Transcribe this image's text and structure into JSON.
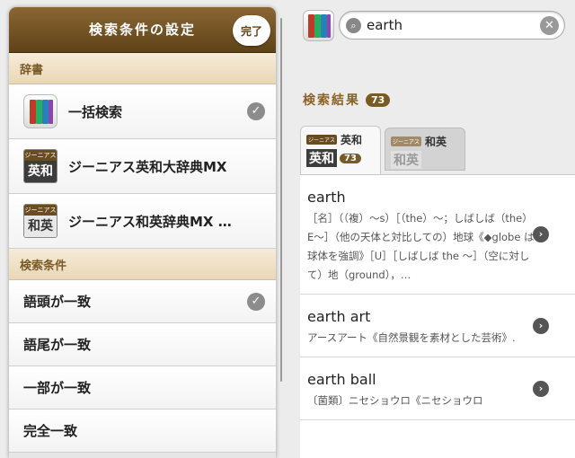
{
  "settings": {
    "title": "検索条件の設定",
    "done_label": "完了",
    "section_dictionary": "辞書",
    "dictionaries": [
      {
        "label": "一括検索",
        "checked": true
      },
      {
        "label": "ジーニアス英和大辞典MX",
        "badge_top": "ジーニアス",
        "badge_bottom": "英和"
      },
      {
        "label": "ジーニアス和英辞典MX …",
        "badge_top": "ジーニアス",
        "badge_bottom": "和英"
      }
    ],
    "section_conditions": "検索条件",
    "conditions": [
      {
        "label": "語頭が一致",
        "checked": true
      },
      {
        "label": "語尾が一致"
      },
      {
        "label": "一部が一致"
      },
      {
        "label": "完全一致"
      }
    ]
  },
  "search": {
    "query": "earth"
  },
  "results_header": {
    "title": "検索結果",
    "count": "73"
  },
  "tabs": [
    {
      "badge_top": "ジーニアス",
      "label": "英和",
      "badge_bottom": "英和",
      "count": "73"
    },
    {
      "badge_top": "ジーニアス",
      "label": "和英",
      "badge_bottom": "和英"
    }
  ],
  "results": [
    {
      "headword": "earth",
      "definition": "［名］（（複）～s）［（the）～；しばしば（the）E～］（他の天体と対比しての）地球《◆globe は球体を強調》［U］［しばしば the ～］（空に対して）地（ground），…"
    },
    {
      "headword": "earth art",
      "definition": "アースアート《自然景観を素材とした芸術》."
    },
    {
      "headword": "earth ball",
      "definition": "〔菌類〕ニセショウロ《ニセショウロ"
    }
  ],
  "colors": {
    "header_brown": "#6f5024",
    "accent_brown": "#7a5a24",
    "section_bg": "#f1e2c8"
  },
  "icons": {
    "check": "check-circle-icon",
    "search": "magnifier-icon",
    "clear": "clear-circle-icon",
    "arrow": "chevron-right-circle-icon"
  }
}
